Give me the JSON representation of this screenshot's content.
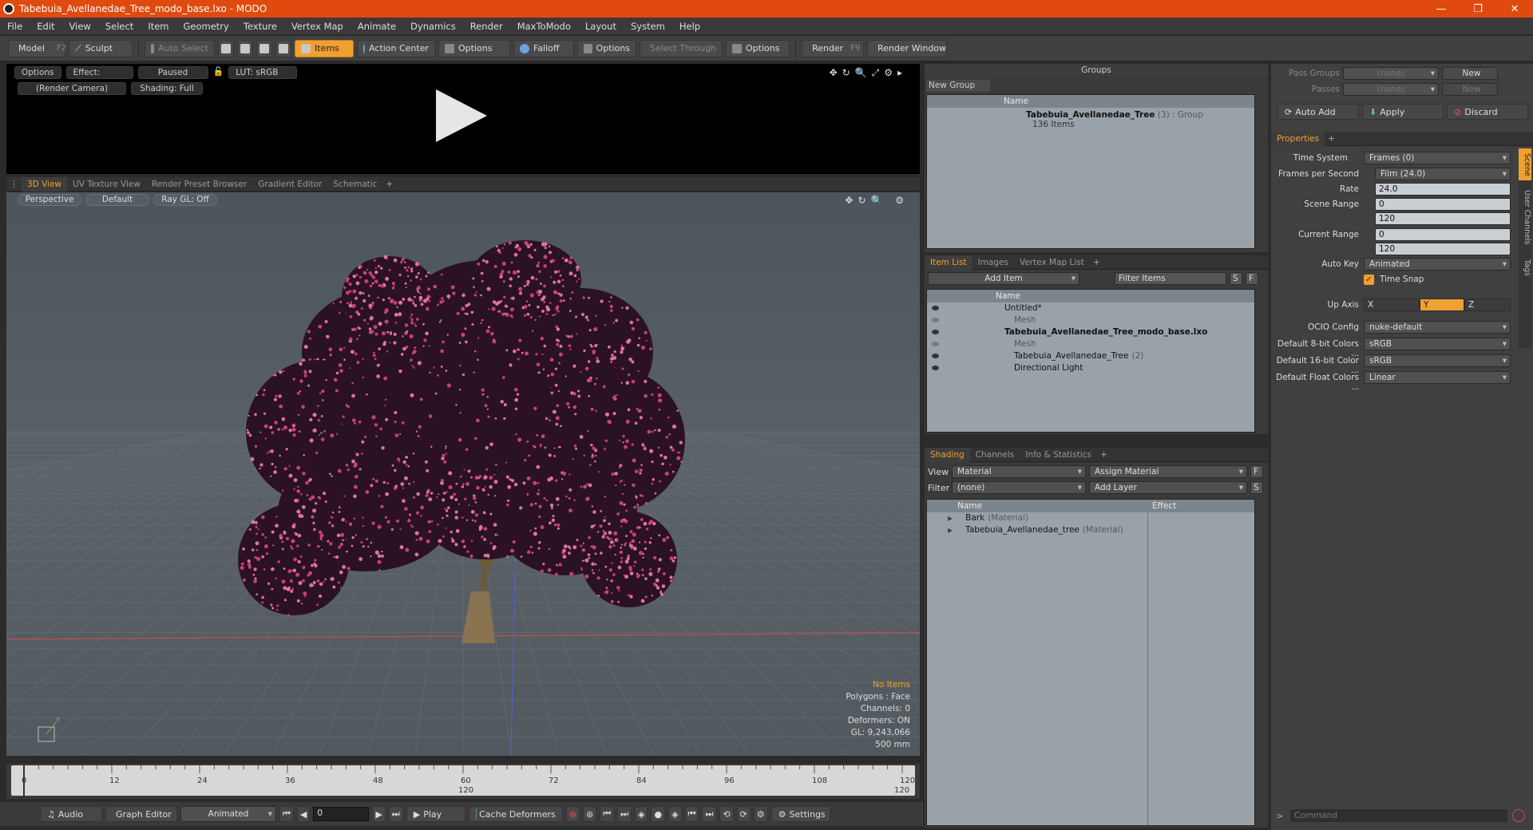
{
  "window": {
    "title": "Tabebuia_Avellanedae_Tree_modo_base.lxo - MODO",
    "minimize": "—",
    "restore": "❐",
    "close": "✕"
  },
  "menu": [
    "File",
    "Edit",
    "View",
    "Select",
    "Item",
    "Geometry",
    "Texture",
    "Vertex Map",
    "Animate",
    "Dynamics",
    "Render",
    "MaxToModo",
    "Layout",
    "System",
    "Help"
  ],
  "toolbar": {
    "model": "Model",
    "model_key": "F2",
    "sculpt": "Sculpt",
    "auto_select": "Auto Select",
    "items": "Items",
    "action_center": "Action Center",
    "options1": "Options",
    "falloff": "Falloff",
    "options2": "Options",
    "select_through": "Select Through",
    "options3": "Options",
    "render": "Render",
    "render_key": "F9",
    "render_window": "Render Window"
  },
  "preview": {
    "options": "Options",
    "effect": "Effect: (Shadi...",
    "paused": "Paused",
    "lut": "LUT: sRGB",
    "camera": "(Render Camera)",
    "shading": "Shading: Full",
    "icons": "✥↻🔍⤢⚙▸"
  },
  "viewport_tabs": {
    "tabs": [
      "3D View",
      "UV Texture View",
      "Render Preset Browser",
      "Gradient Editor",
      "Schematic"
    ],
    "plus": "+"
  },
  "viewport": {
    "perspective": "Perspective",
    "default": "Default",
    "raygl": "Ray GL: Off",
    "icons": "✥↻🔍 ⚙",
    "hud": {
      "no_items": "No Items",
      "polygons": "Polygons : Face",
      "channels": "Channels: 0",
      "deformers": "Deformers: ON",
      "gl": "GL: 9,243,066",
      "scale": "500 mm"
    }
  },
  "timeline": {
    "ticks": [
      "0",
      "12",
      "24",
      "36",
      "48",
      "60",
      "72",
      "84",
      "96",
      "108",
      "120"
    ],
    "mid": "120",
    "end": "120"
  },
  "bottombar": {
    "audio": "Audio",
    "graph_editor": "Graph Editor",
    "animated": "Animated",
    "frame": "0",
    "play": "Play",
    "cache_deformers": "Cache Deformers",
    "settings": "Settings"
  },
  "groups": {
    "title": "Groups",
    "new_group": "New Group",
    "col_name": "Name",
    "item_name": "Tabebuia_Avellanedae_Tree",
    "item_count": "(3)",
    "item_type": ": Group",
    "item_sub": "136 Items"
  },
  "itemlist": {
    "tabs": [
      "Item List",
      "Images",
      "Vertex Map List"
    ],
    "plus": "+",
    "add_item": "Add Item",
    "filter": "Filter Items",
    "s": "S",
    "f": "F",
    "col_name": "Name",
    "rows": [
      {
        "label": "Untitled*",
        "style": "normal",
        "indent": 1
      },
      {
        "label": "Mesh",
        "style": "dim",
        "indent": 2
      },
      {
        "label": "Tabebuia_Avellanedae_Tree_modo_base.lxo",
        "style": "bold",
        "indent": 1
      },
      {
        "label": "Mesh",
        "style": "dim",
        "indent": 2
      },
      {
        "label": "Tabebuia_Avellanedae_Tree",
        "extra": "(2)",
        "style": "normal",
        "indent": 2
      },
      {
        "label": "Directional Light",
        "style": "normal",
        "indent": 2
      }
    ]
  },
  "shading": {
    "tabs": [
      "Shading",
      "Channels",
      "Info & Statistics"
    ],
    "plus": "+",
    "view_label": "View",
    "view_value": "Material",
    "assign": "Assign Material",
    "f": "F",
    "filter_label": "Filter",
    "filter_value": "(none)",
    "add_layer": "Add Layer",
    "s": "S",
    "col_name": "Name",
    "col_effect": "Effect",
    "rows": [
      {
        "name": "Bark",
        "type": "(Material)"
      },
      {
        "name": "Tabebuia_Avellanedae_tree",
        "type": "(Material)"
      }
    ]
  },
  "properties": {
    "pass_groups": "Pass Groups",
    "pass_groups_val": "(none)",
    "passes": "Passes",
    "passes_val": "(none)",
    "new1": "New",
    "new2": "New",
    "auto_add": "Auto Add",
    "apply": "Apply",
    "discard": "Discard",
    "tab": "Properties",
    "plus": "+",
    "side_tabs": [
      "Scene",
      "User Channels",
      "Tags"
    ],
    "time_system": "Time System",
    "time_system_val": "Frames (0)",
    "fps": "Frames per Second",
    "fps_val": "Film (24.0)",
    "rate": "Rate",
    "rate_val": "24.0",
    "scene_range": "Scene Range",
    "scene_range_a": "0",
    "scene_range_b": "120",
    "current_range": "Current Range",
    "current_range_a": "0",
    "current_range_b": "120",
    "auto_key": "Auto Key",
    "auto_key_val": "Animated",
    "time_snap": "Time Snap",
    "up_axis": "Up Axis",
    "x": "X",
    "y": "Y",
    "z": "Z",
    "ocio": "OCIO Config",
    "ocio_val": "nuke-default",
    "d8": "Default 8-bit Colors ...",
    "d8_val": "sRGB",
    "d16": "Default 16-bit Color ...",
    "d16_val": "sRGB",
    "dfloat": "Default Float Colors ...",
    "dfloat_val": "Linear",
    "command": "Command"
  },
  "colors": {
    "accent": "#f0a030",
    "titlebar": "#e04a0e",
    "blossom": "#c8407a"
  }
}
